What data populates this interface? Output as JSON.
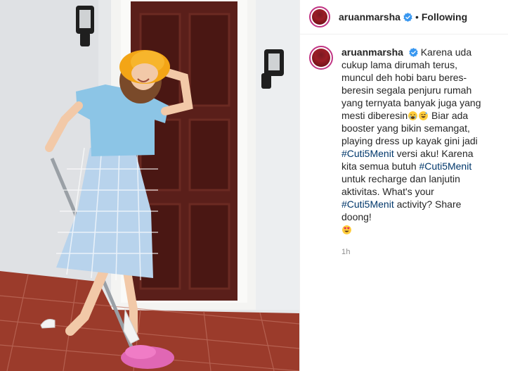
{
  "post": {
    "username": "aruanmarsha",
    "dot": "•",
    "follow_status": "Following"
  },
  "caption": {
    "username": "aruanmarsha",
    "part1": "Karena uda cukup lama dirumah terus, muncul deh hobi baru beres-beresin segala penjuru rumah yang ternyata banyak juga yang mesti diberesin",
    "part2": " Biar ada booster yang bikin semangat, playing dress up kayak gini jadi ",
    "hashtag1": "#Cuti5Menit",
    "part3": " versi aku! Karena kita semua butuh ",
    "hashtag2": "#Cuti5Menit",
    "part4": " untuk recharge dan lanjutin aktivitas. What's your ",
    "hashtag3": "#Cuti5Menit",
    "part5": " activity? Share doong!",
    "emojis": [
      "weary-cry-emoji",
      "grin-sweat-emoji",
      "heart-eyes-emoji"
    ]
  },
  "timestamp": "1h",
  "colors": {
    "hashtag": "#00376b",
    "username": "#262626",
    "timestamp": "#8e8e8e",
    "story_ring": "#c13584",
    "verified": "#3897f0"
  }
}
